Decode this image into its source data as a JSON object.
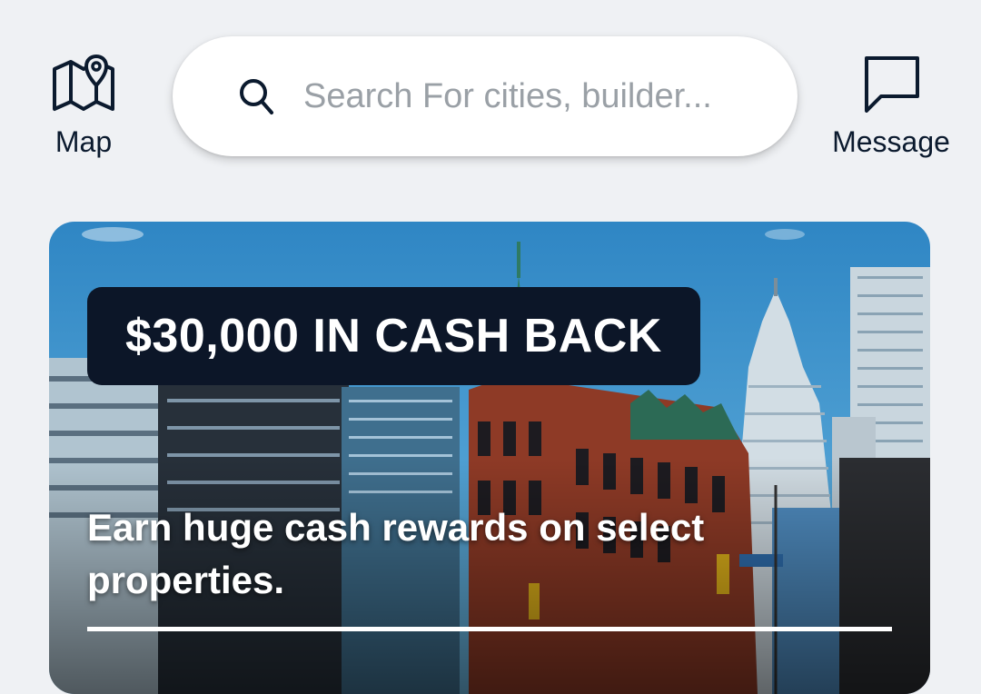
{
  "topbar": {
    "map_label": "Map",
    "map_icon": "map-pin-icon",
    "message_label": "Message",
    "message_icon": "chat-bubble-icon",
    "search_placeholder": "Search For cities, builder...",
    "search_icon": "search-icon"
  },
  "promo": {
    "badge": "$30,000 IN CASH BACK",
    "caption": "Earn huge cash rewards on select properties."
  },
  "colors": {
    "background": "#eff1f4",
    "badge_bg": "#0c1628",
    "icon_stroke": "#0b1a2e",
    "sky": "#3d94cc"
  }
}
